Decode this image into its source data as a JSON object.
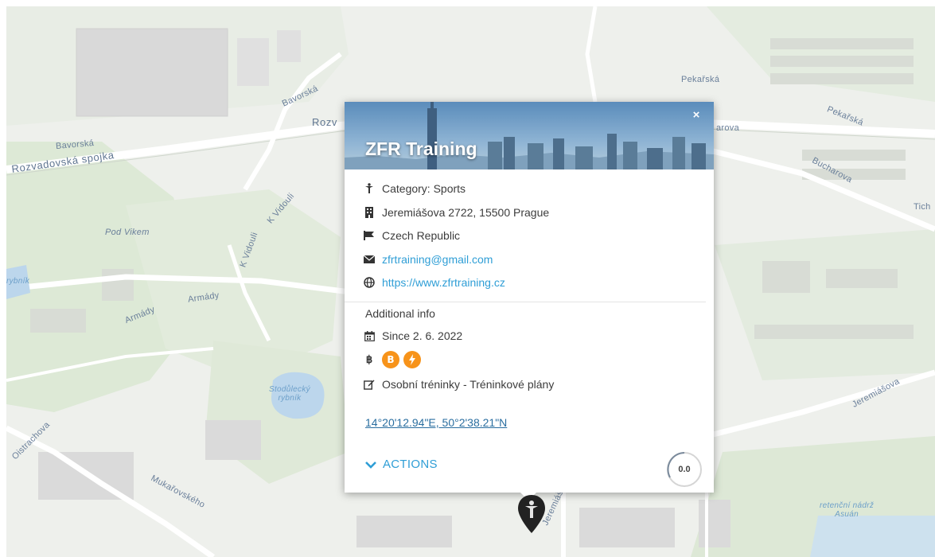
{
  "map": {
    "streets": {
      "bavorska_top": "Bavorská",
      "rozvadovska_partial": "Rozv",
      "bavorska_left": "Bavorská",
      "rozvadovska_spojka": "Rozvadovská spojka",
      "pekarska_top": "Pekařská",
      "pekarska_right": "Pekařská",
      "arova_partial": "arova",
      "bucharova": "Bucharova",
      "tich_partial": "Tich",
      "pod_vikem": "Pod Vikem",
      "k_vidouli_1": "K Vidouli",
      "k_vidouli_2": "K Vidouli",
      "rybnik_left": "rybník",
      "armady_1": "Armády",
      "armady_2": "Armády",
      "jeremiasova_right": "Jeremiášova",
      "jeremiasova_bottom": "Jeremiášova",
      "oistrachova": "Oistrachova",
      "mukarovskeho": "Mukařovského"
    },
    "water": {
      "stodulecky_line1": "Stodůlecký",
      "stodulecky_line2": "rybník",
      "retencni_line1": "retenční nádrž",
      "retencni_line2": "Asuán"
    }
  },
  "popup": {
    "title": "ZFR Training",
    "close_icon": "×",
    "category": "Category: Sports",
    "address": "Jeremiášova 2722, 15500 Prague",
    "country": "Czech Republic",
    "email": "zfrtraining@gmail.com",
    "website": "https://www.zfrtraining.cz",
    "additional_title": "Additional info",
    "since": "Since 2. 6. 2022",
    "bitcoin_symbol": "฿",
    "description": "Osobní tréninky - Tréninkové plány",
    "coordinates": "14°20'12.94\"E, 50°2'38.21\"N",
    "actions_label": "ACTIONS",
    "rating": "0.0"
  },
  "icons": {
    "category": "sports-icon",
    "address": "building-icon",
    "country": "flag-icon",
    "email": "envelope-icon",
    "website": "globe-icon",
    "since": "calendar-icon",
    "bitcoin": "bitcoin-icon",
    "lightning": "lightning-icon",
    "description": "edit-icon",
    "actions": "chevron-down-icon",
    "marker": "map-marker-icon"
  },
  "colors": {
    "link": "#2f9ed6",
    "bitcoin": "#f7931a",
    "road_green": "#dbe9d8",
    "water": "#bcd6ec",
    "street_label": "#6a7f9a"
  }
}
